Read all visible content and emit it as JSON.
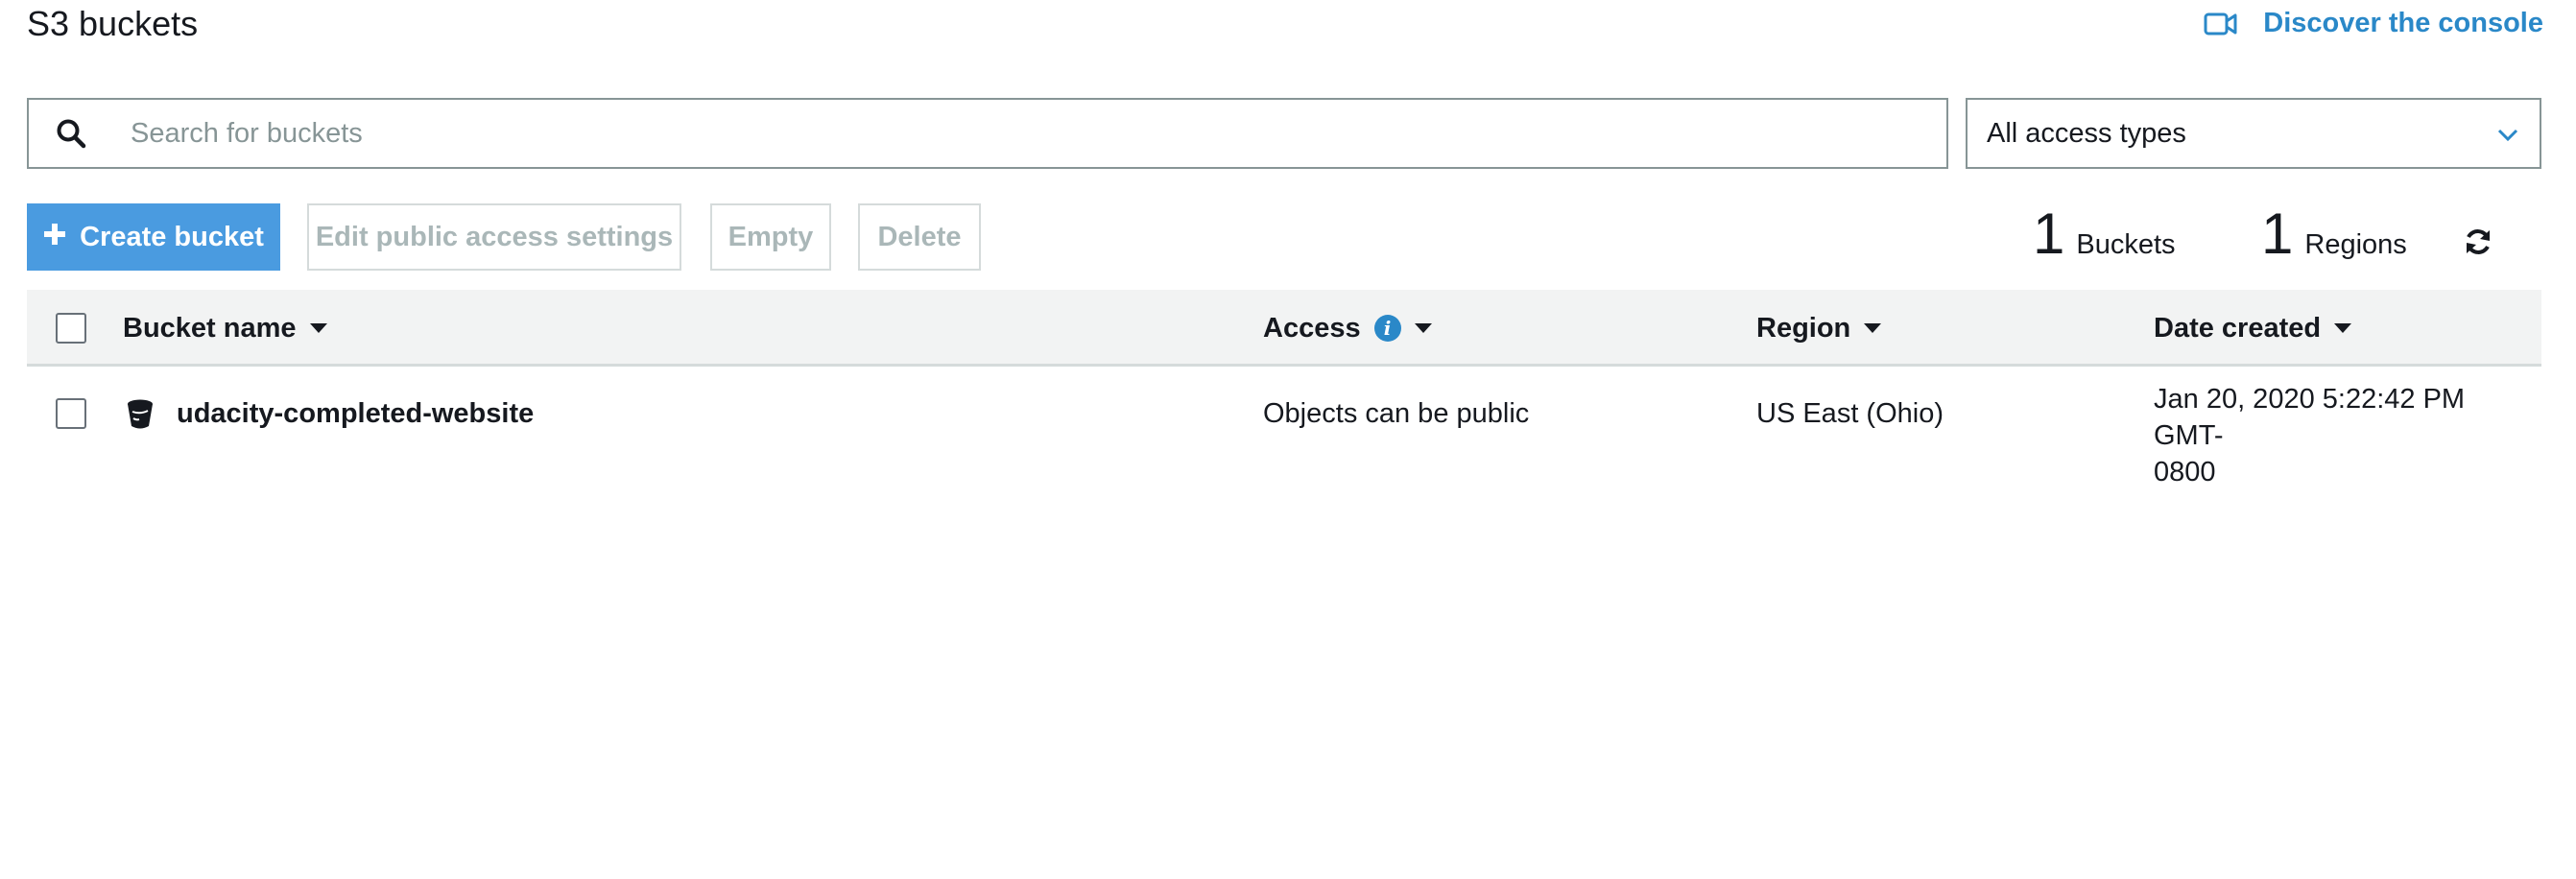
{
  "header": {
    "title": "S3 buckets",
    "discover_label": "Discover the console",
    "discover_icon": "video-icon"
  },
  "search": {
    "placeholder": "Search for buckets",
    "value": ""
  },
  "access_filter": {
    "selected": "All access types"
  },
  "actions": {
    "create_label": "Create bucket",
    "edit_label": "Edit public access settings",
    "empty_label": "Empty",
    "delete_label": "Delete"
  },
  "summary": {
    "buckets_count": "1",
    "buckets_label": "Buckets",
    "regions_count": "1",
    "regions_label": "Regions"
  },
  "table": {
    "columns": {
      "name": "Bucket name",
      "access": "Access",
      "region": "Region",
      "date": "Date created"
    },
    "rows": [
      {
        "name": "udacity-completed-website",
        "access": "Objects can be public",
        "region": "US East (Ohio)",
        "date_line1": "Jan 20, 2020 5:22:42 PM GMT-",
        "date_line2": "0800"
      }
    ]
  },
  "colors": {
    "primary": "#4a9be0",
    "link": "#2a88c8",
    "border": "#879596",
    "header_bg": "#f2f3f3"
  }
}
